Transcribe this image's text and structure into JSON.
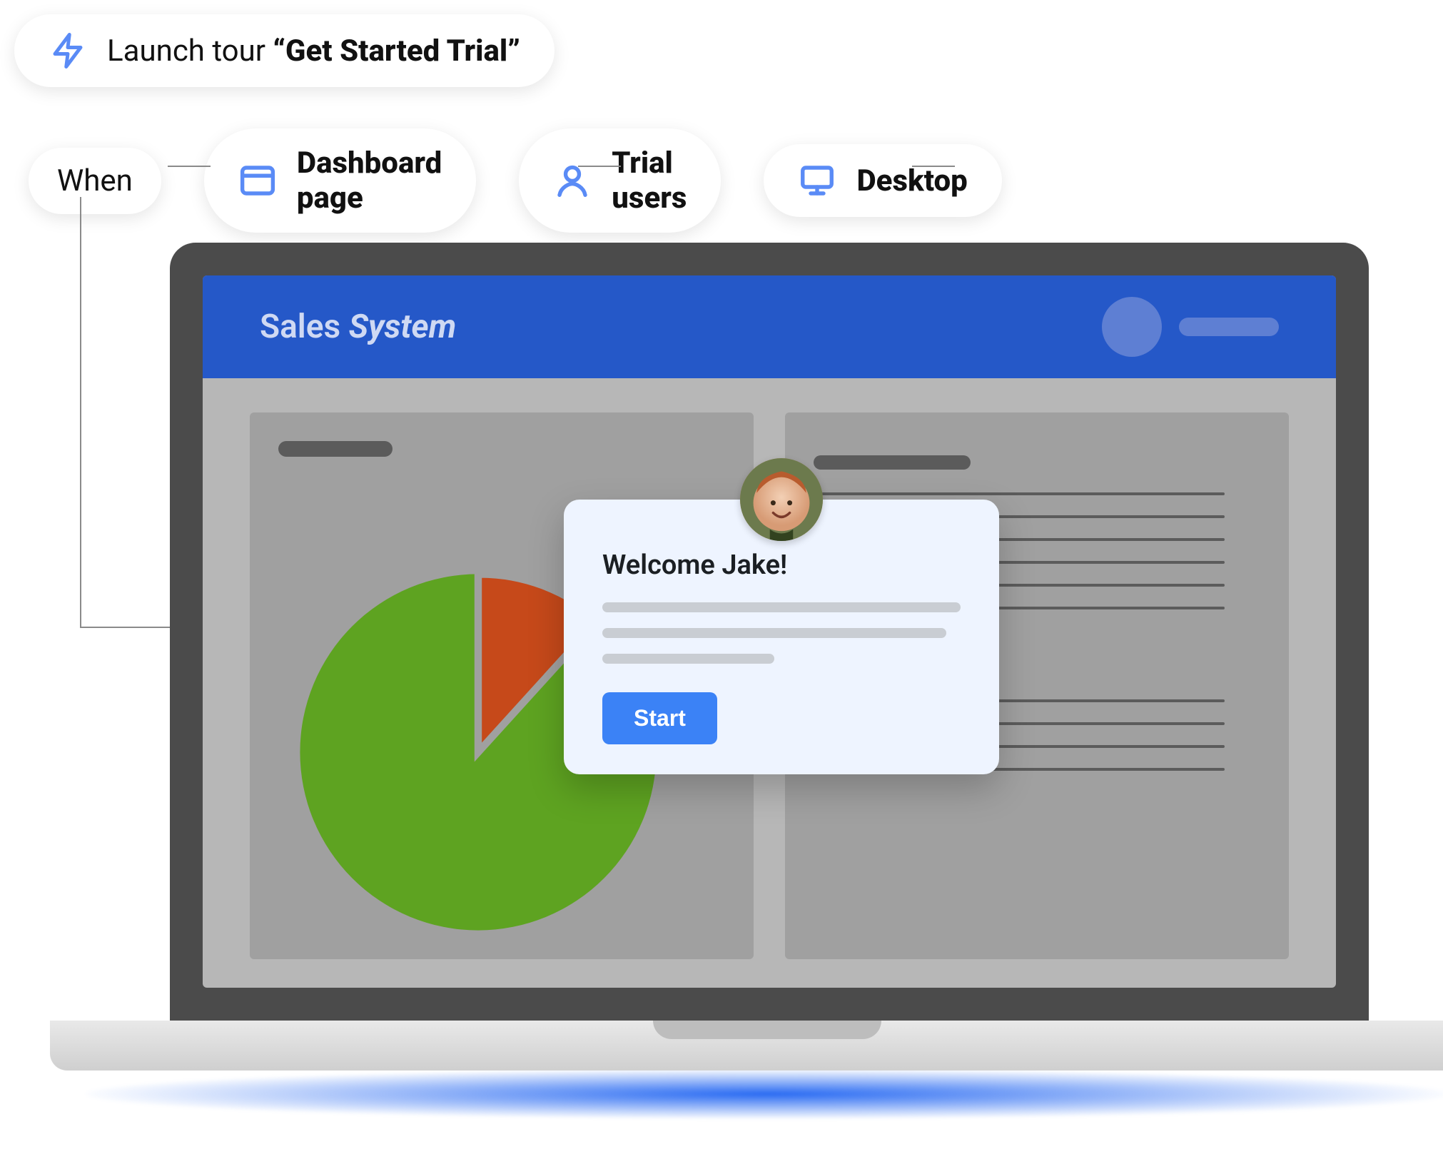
{
  "rules": {
    "launch": {
      "prefix": "Launch tour ",
      "tour_name": "“Get Started Trial”"
    },
    "when_label": "When",
    "conditions": [
      {
        "icon": "dashboard",
        "label": "Dashboard page"
      },
      {
        "icon": "user",
        "label": "Trial users"
      },
      {
        "icon": "desktop",
        "label": "Desktop"
      }
    ]
  },
  "app": {
    "brand_first": "Sales",
    "brand_second": "System"
  },
  "popup": {
    "title": "Welcome Jake!",
    "cta": "Start"
  },
  "chart_data": {
    "type": "pie",
    "title": "",
    "series": [
      {
        "name": "green-slice",
        "value": 88,
        "color": "#5ea321"
      },
      {
        "name": "orange-slice",
        "value": 12,
        "color": "#c6491a"
      }
    ]
  },
  "colors": {
    "accent": "#3b82f6",
    "header": "#2558c8"
  }
}
